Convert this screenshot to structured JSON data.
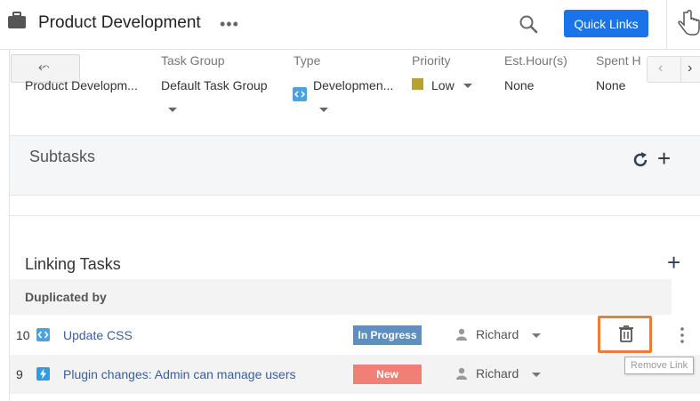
{
  "header": {
    "title": "Product Development",
    "more_label": "•••",
    "quick_links_label": "Quick Links",
    "icons": [
      "briefcase-icon",
      "search-icon",
      "hand-pointer-icon"
    ],
    "accent_color": "#1a73e8"
  },
  "fields": {
    "back_label": "⬿",
    "project_value": "Product Developm...",
    "task_group": {
      "label": "Task Group",
      "value": "Default Task Group"
    },
    "type": {
      "label": "Type",
      "value": "Developmen..."
    },
    "priority": {
      "label": "Priority",
      "value": "Low",
      "color": "#b5a22f"
    },
    "est_hours": {
      "label": "Est.Hour(s)",
      "value": "None"
    },
    "spent_hours": {
      "label": "Spent H",
      "value": "None"
    },
    "nav_prev": "‹",
    "nav_next": "›"
  },
  "subtasks": {
    "title": "Subtasks",
    "add_label": "+"
  },
  "linking": {
    "title": "Linking Tasks",
    "add_label": "+",
    "group_label": "Duplicated by",
    "rows": [
      {
        "id": "10",
        "name": "Update CSS",
        "status": "In Progress",
        "assignee": "Richard",
        "type_icon": "code-icon"
      },
      {
        "id": "9",
        "name": "Plugin changes: Admin can manage users",
        "status": "New",
        "assignee": "Richard",
        "type_icon": "lightning-icon"
      }
    ],
    "tooltip": "Remove Link"
  }
}
